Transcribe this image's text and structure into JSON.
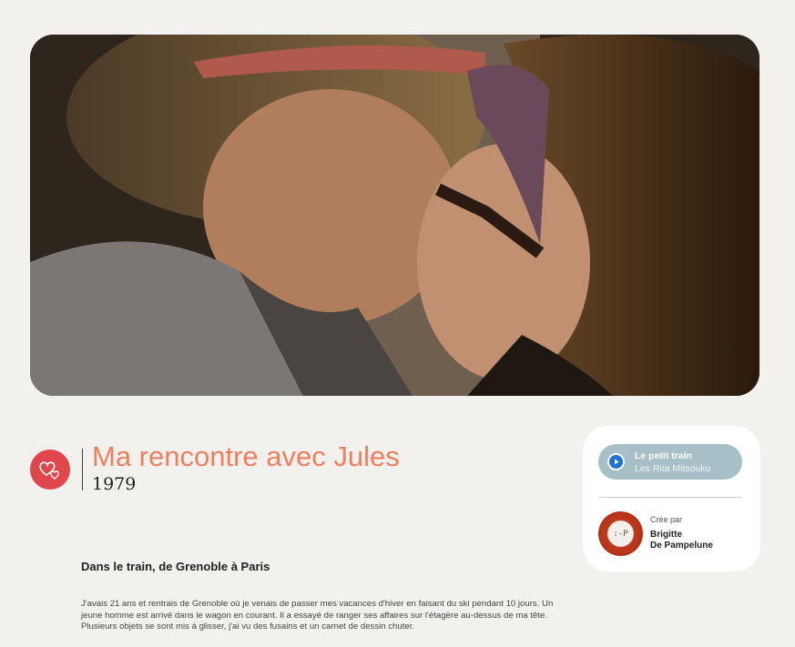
{
  "hero": {
    "alt": "Couple s'embrassant"
  },
  "story": {
    "title": "Ma rencontre avec Jules",
    "year": "1979",
    "subtitle": "Dans le train, de Grenoble à Paris",
    "body": "J'avais 21 ans et rentrais de Grenoble où je venais de passer mes vacances d'hiver en faisant du ski pendant 10 jours. Un jeune homme est arrivé dans le wagon en courant. Il a essayé de ranger ses affaires sur l'étagère au-dessus de ma tête. Plusieurs objets se sont mis à glisser, j'ai vu des fusains et un carnet de dessin chuter."
  },
  "music": {
    "song": "Le petit train",
    "artist": "Les Rita Mitsouko"
  },
  "creator": {
    "label": "Crée par",
    "first_name": "Brigitte",
    "last_name": "De Pampelune",
    "avatar_text": ":-P"
  },
  "colors": {
    "accent": "#ee7f5f",
    "heart_badge": "#e0474c",
    "music_pill": "#a7bfc6",
    "background": "#f3f1ee"
  },
  "icons": {
    "badge": "two-hearts-icon",
    "play": "play-icon"
  }
}
